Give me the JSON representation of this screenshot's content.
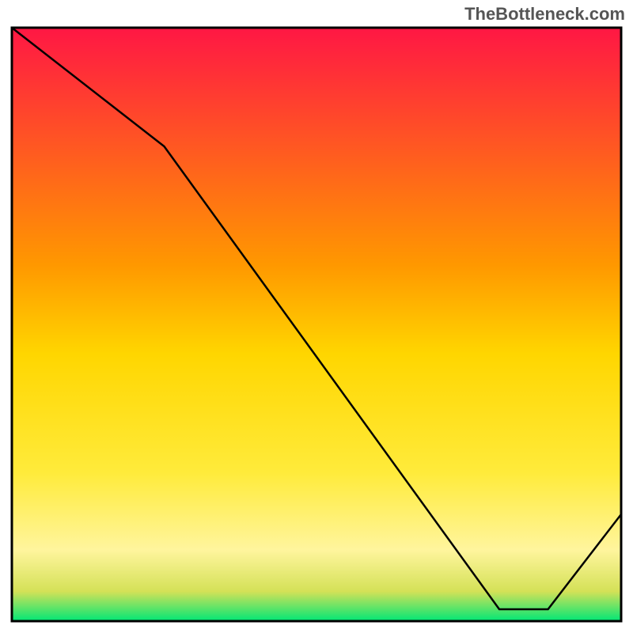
{
  "watermark": "TheBottleneck.com",
  "chart_data": {
    "type": "line",
    "title": "",
    "xlabel": "",
    "ylabel": "",
    "xlim": [
      0,
      100
    ],
    "ylim": [
      0,
      100
    ],
    "x": [
      0,
      25,
      80,
      88,
      100
    ],
    "values": [
      100,
      80,
      2,
      2,
      18
    ],
    "gradient_stops": [
      {
        "offset": 0,
        "color": "#ff1744"
      },
      {
        "offset": 40,
        "color": "#ff9800"
      },
      {
        "offset": 55,
        "color": "#ffd600"
      },
      {
        "offset": 75,
        "color": "#ffeb3b"
      },
      {
        "offset": 88,
        "color": "#fff59d"
      },
      {
        "offset": 95,
        "color": "#d4e157"
      },
      {
        "offset": 100,
        "color": "#00e676"
      }
    ],
    "annotation": {
      "text": "",
      "x": 83,
      "y": 1
    }
  }
}
